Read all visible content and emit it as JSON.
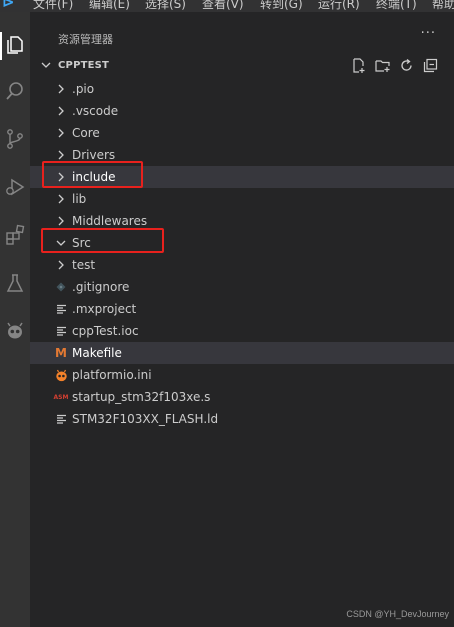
{
  "menubar": {
    "items": [
      "文件(F)",
      "编辑(E)",
      "选择(S)",
      "查看(V)",
      "转到(G)",
      "运行(R)",
      "终端(T)",
      "帮助"
    ]
  },
  "sidebar": {
    "title": "资源管理器",
    "more": "···",
    "section": {
      "label": "CPPTEST"
    }
  },
  "tree": [
    {
      "name": ".pio",
      "type": "folder",
      "expanded": false
    },
    {
      "name": ".vscode",
      "type": "folder",
      "expanded": false
    },
    {
      "name": "Core",
      "type": "folder",
      "expanded": false
    },
    {
      "name": "Drivers",
      "type": "folder",
      "expanded": false
    },
    {
      "name": "include",
      "type": "folder",
      "expanded": false,
      "highlighted": true
    },
    {
      "name": "lib",
      "type": "folder",
      "expanded": false
    },
    {
      "name": "Middlewares",
      "type": "folder",
      "expanded": false
    },
    {
      "name": "Src",
      "type": "folder",
      "expanded": true
    },
    {
      "name": "test",
      "type": "folder",
      "expanded": false
    },
    {
      "name": ".gitignore",
      "type": "file",
      "icon": "git-diamond-icon"
    },
    {
      "name": ".mxproject",
      "type": "file",
      "icon": "lines-file-icon"
    },
    {
      "name": "cppTest.ioc",
      "type": "file",
      "icon": "lines-file-icon"
    },
    {
      "name": "Makefile",
      "type": "file",
      "icon": "makefile-m-icon",
      "highlighted": true
    },
    {
      "name": "platformio.ini",
      "type": "file",
      "icon": "platformio-alien-icon"
    },
    {
      "name": "startup_stm32f103xe.s",
      "type": "file",
      "icon": "asm-icon",
      "badge": "ASM"
    },
    {
      "name": "STM32F103XX_FLASH.ld",
      "type": "file",
      "icon": "lines-file-icon"
    }
  ],
  "colors": {
    "activity_bar": "#333333",
    "sidebar": "#252526",
    "highlight_row": "#37373d",
    "annotation": "#e8211d",
    "makefile_icon": "#e37933",
    "platformio_icon": "#f5822a",
    "asm_icon": "#d23f31"
  },
  "watermark": "CSDN @YH_DevJourney"
}
